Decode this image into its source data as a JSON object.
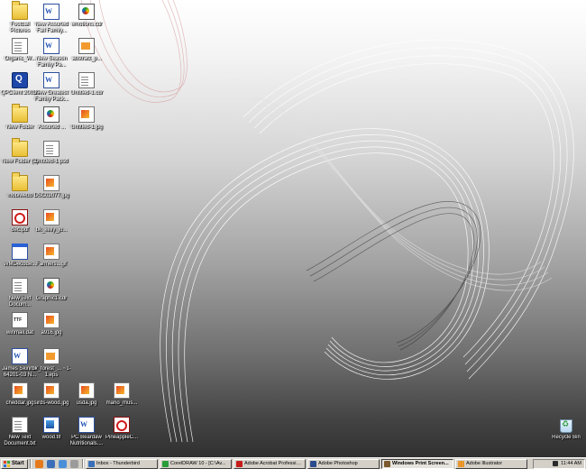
{
  "desktop": {
    "icons": [
      {
        "label": "Football Pictures",
        "type": "folder"
      },
      {
        "label": "New Assorted Fall Family...",
        "type": "word"
      },
      {
        "label": "emotions.cdr",
        "type": "cdr"
      },
      {
        "label": "Organic_W...",
        "type": "doc"
      },
      {
        "label": "New Season Family Pa...",
        "type": "word"
      },
      {
        "label": "abstract_p...",
        "type": "eps"
      },
      {
        "label": "QPClient 2001A",
        "type": "app"
      },
      {
        "label": "New Greatest Family Pack...",
        "type": "word"
      },
      {
        "label": "Untitled-1.cdr",
        "type": "doc"
      },
      {
        "label": "New Folder",
        "type": "folder"
      },
      {
        "label": "Assorted ...",
        "type": "cdr"
      },
      {
        "label": "Untitled-1.jpg",
        "type": "jpg"
      },
      {
        "label": "New Folder (2)",
        "type": "folder"
      },
      {
        "label": "Untitled-1.psd",
        "type": "doc"
      },
      {
        "label": "mobiwebb",
        "type": "folder"
      },
      {
        "label": "DSC02077.jpg",
        "type": "jpg"
      },
      {
        "label": "dec.pdf",
        "type": "pdf"
      },
      {
        "label": "bk_kelly_jo...",
        "type": "jpg"
      },
      {
        "label": "WMDecode...",
        "type": "window"
      },
      {
        "label": "Farmers...gif",
        "type": "jpg"
      },
      {
        "label": "New Text Docum...",
        "type": "doc"
      },
      {
        "label": "Graphic1.cdr",
        "type": "cdr"
      },
      {
        "label": "winmail.dat",
        "type": "ttf"
      },
      {
        "label": "a916.jpg",
        "type": "jpg"
      },
      {
        "label": "James Skinner 64201-03 N...",
        "type": "word"
      },
      {
        "label": "bk_forest_... ~1-1.eps",
        "type": "eps"
      },
      {
        "label": "cheddar.jpg",
        "type": "jpg"
      },
      {
        "label": "sirds-wood.jpg",
        "type": "jpg"
      },
      {
        "label": "usda.jpg",
        "type": "jpg"
      },
      {
        "label": "mario_mus...",
        "type": "jpg"
      },
      {
        "label": "New Text Document.txt",
        "type": "doc"
      },
      {
        "label": "wood.tif",
        "type": "tif"
      },
      {
        "label": "PC Beardaw Nutritionals....",
        "type": "word"
      },
      {
        "label": "PineappleC...",
        "type": "pdf"
      },
      {
        "label": "Recycle Bin",
        "type": "recycle"
      }
    ]
  },
  "taskbar": {
    "start_label": "Start",
    "tasks": [
      {
        "label": "Inbox - Thunderbird",
        "color": "#3b6fb8"
      },
      {
        "label": "CorelDRAW 10 - [C:\\Av...",
        "color": "#2a9c3a"
      },
      {
        "label": "Adobe Acrobat Professio...",
        "color": "#c61c1c"
      },
      {
        "label": "Adobe Photoshop",
        "color": "#2a4c8f"
      },
      {
        "label": "Windows Print Screen...",
        "color": "#7a5a2e"
      },
      {
        "label": "Adobe Illustrator",
        "color": "#e9962a"
      }
    ],
    "active_task_index": 4,
    "clock": "11:44 AM"
  }
}
